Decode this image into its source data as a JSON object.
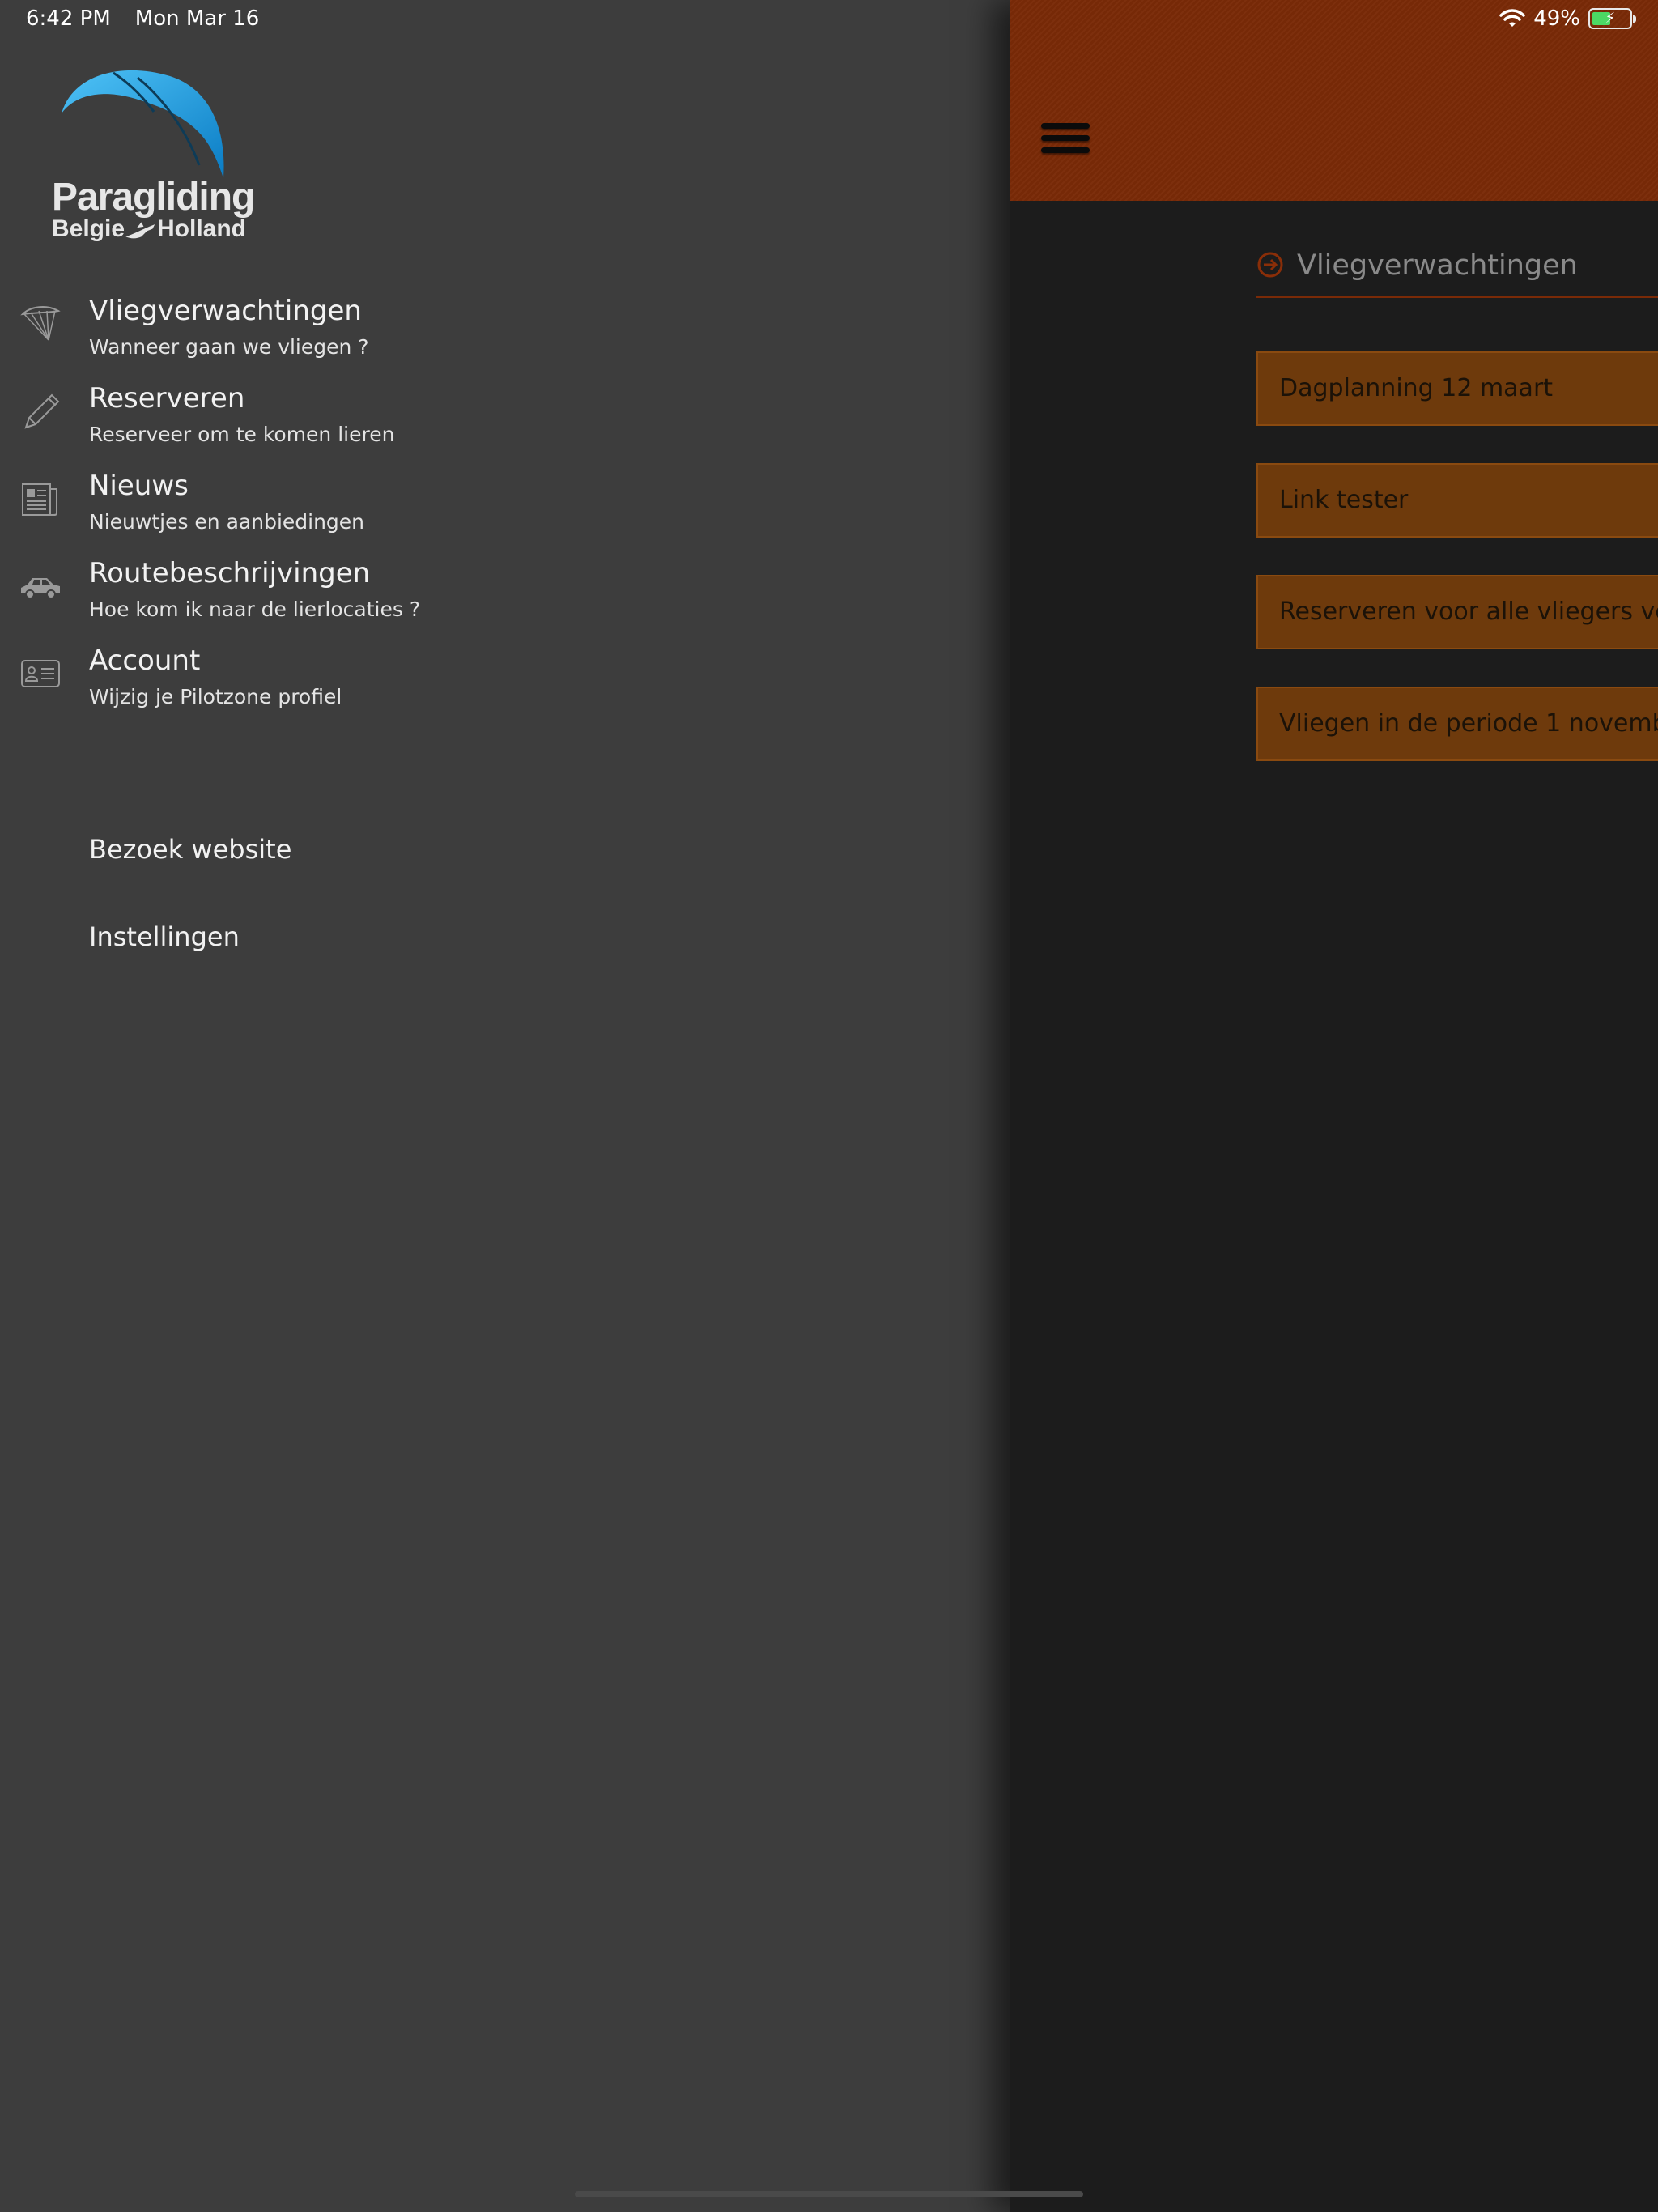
{
  "status_bar": {
    "time": "6:42 PM",
    "date": "Mon Mar 16",
    "battery": "49%",
    "battery_level": 0.49
  },
  "logo": {
    "title": "Paragliding",
    "left": "Belgie",
    "right": "Holland"
  },
  "menu": [
    {
      "title": "Vliegverwachtingen",
      "subtitle": "Wanneer gaan we vliegen ?",
      "icon": "paraglider-icon"
    },
    {
      "title": "Reserveren",
      "subtitle": "Reserveer om te komen lieren",
      "icon": "pencil-icon"
    },
    {
      "title": "Nieuws",
      "subtitle": "Nieuwtjes en aanbiedingen",
      "icon": "newspaper-icon"
    },
    {
      "title": "Routebeschrijvingen",
      "subtitle": "Hoe kom ik naar de lierlocaties ?",
      "icon": "car-icon"
    },
    {
      "title": "Account",
      "subtitle": "Wijzig je Pilotzone profiel",
      "icon": "id-card-icon"
    }
  ],
  "links": {
    "website": "Bezoek website",
    "settings": "Instellingen"
  },
  "main": {
    "section_title": "Vliegverwachtingen",
    "posts": [
      "Dagplanning 12 maart",
      "Link tester",
      "Reserveren voor alle vliegers ve",
      "Vliegen in de periode 1 novemb"
    ]
  },
  "colors": {
    "drawer_bg": "#3d3d3d",
    "header_bg": "#7a2a07",
    "post_bg": "#6e3a0c",
    "content_bg": "#1c1c1c",
    "logo_blue": "#1aa3e6"
  }
}
